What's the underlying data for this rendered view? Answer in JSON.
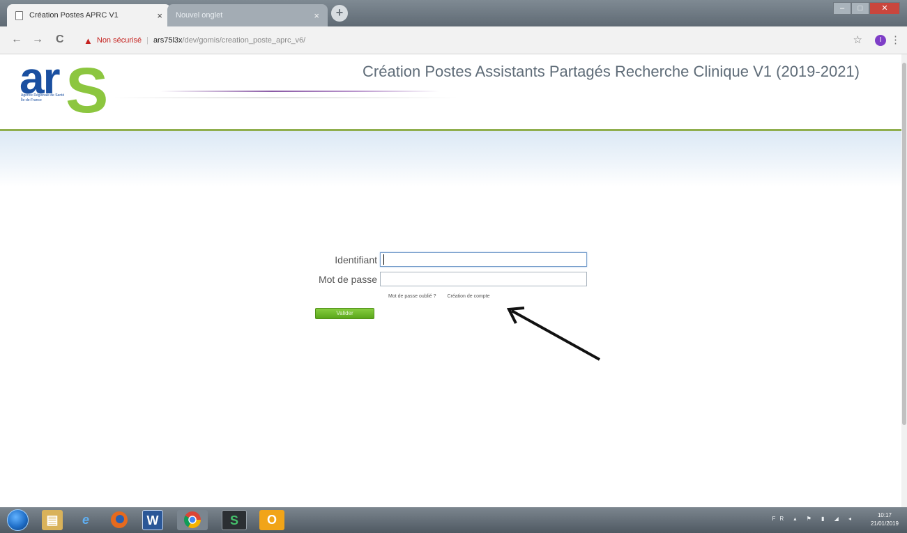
{
  "browser": {
    "tabs": [
      {
        "title": "Création Postes APRC V1",
        "close": "×"
      },
      {
        "title": "Nouvel onglet",
        "close": "×"
      }
    ],
    "new_tab_symbol": "+",
    "nav": {
      "back": "←",
      "forward": "→",
      "reload": "C"
    },
    "security_warning": "Non sécurisé",
    "separator": "|",
    "url_host": "ars75l3x",
    "url_path": "/dev/gomis/creation_poste_aprc_v6/",
    "star": "☆",
    "profile_initial": "I",
    "menu": "⋮"
  },
  "header": {
    "logo_text": "ar",
    "logo_s": "S",
    "logo_caption": "Agence Régionale de Santé Île-de-France",
    "title": "Création Postes Assistants Partagés Recherche Clinique V1 (2019-2021)"
  },
  "login": {
    "identifiant_label": "Identifiant",
    "identifiant_value": "",
    "password_label": "Mot de passe",
    "password_value": "",
    "forgot_password": "Mot de passe oublié ?",
    "create_account": "Création de compte",
    "submit_label": "Valider"
  },
  "taskbar": {
    "apps": [
      "explorer",
      "internet-explorer",
      "firefox",
      "word",
      "chrome",
      "app-s",
      "outlook"
    ],
    "tray_language": "FR",
    "time": "10:17",
    "date": "21/01/2019"
  },
  "colors": {
    "brand_blue": "#1a4fa0",
    "brand_green": "#8cc63f",
    "header_rule": "#8fae4d",
    "button_green": "#5aa71b"
  }
}
